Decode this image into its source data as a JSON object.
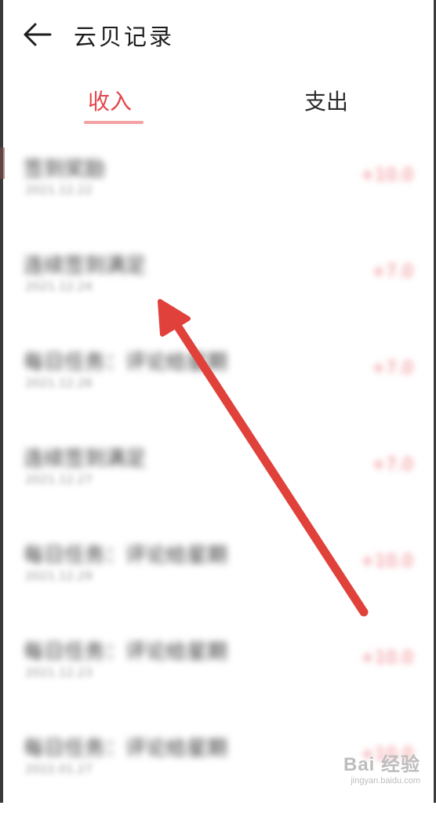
{
  "header": {
    "title": "云贝记录",
    "back_icon": "arrow-left-icon"
  },
  "tabs": [
    {
      "label": "收入",
      "active": true
    },
    {
      "label": "支出",
      "active": false
    }
  ],
  "records": [
    {
      "title": "签到奖励",
      "date": "2021.12.22",
      "amount": "+10.0"
    },
    {
      "title": "连续签到满足",
      "date": "2021.12.24",
      "amount": "+7.0"
    },
    {
      "title": "每日任务：评论给星期",
      "date": "2021.12.26",
      "amount": "+7.0"
    },
    {
      "title": "连续签到满足",
      "date": "2021.12.27",
      "amount": "+7.0"
    },
    {
      "title": "每日任务：评论给星期",
      "date": "2021.12.29",
      "amount": "+10.0"
    },
    {
      "title": "每日任务：评论给星期",
      "date": "2021.12.23",
      "amount": "+10.0"
    },
    {
      "title": "每日任务：评论给星期",
      "date": "2022.01.27",
      "amount": "+10.0"
    }
  ],
  "colors": {
    "accent": "#e2474c",
    "arrow": "#e0413b"
  },
  "watermark": {
    "main": "Bai 经验",
    "sub": "jingyan.baidu.com"
  }
}
